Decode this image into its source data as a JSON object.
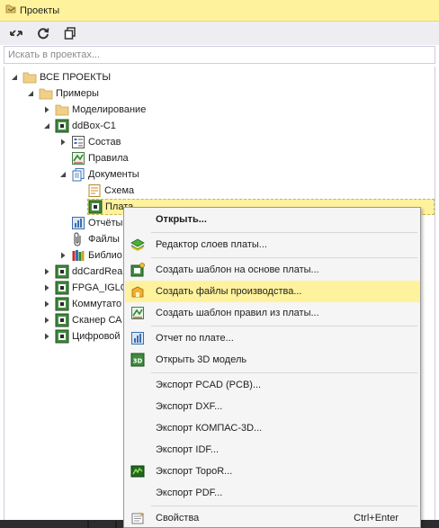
{
  "window": {
    "title": "Проекты"
  },
  "toolbar": {
    "buttons": [
      "sync-icon",
      "refresh-icon",
      "copy-icon"
    ]
  },
  "search": {
    "placeholder": "Искать в проектах..."
  },
  "tree": {
    "root": "ВСЕ ПРОЕКТЫ",
    "examples": "Примеры",
    "modeling": "Моделирование",
    "ddbox": "ddBox-C1",
    "sostav": "Состав",
    "pravila": "Правила",
    "documents": "Документы",
    "schema": "Схема",
    "plata": "Плата",
    "reports": "Отчёты",
    "files": "Файлы",
    "libraries": "Библио",
    "ddcard": "ddCardRea",
    "fpga": "FPGA_IGLO",
    "kommutator": "Коммутато",
    "scanner": "Сканер СА",
    "digital": "Цифровой"
  },
  "context_menu": {
    "open": "Открыть...",
    "layer_editor": "Редактор слоев платы...",
    "create_template": "Создать шаблон на основе платы...",
    "create_production": "Создать файлы производства...",
    "create_rules_template": "Создать шаблон правил из платы...",
    "board_report": "Отчет по плате...",
    "open_3d": "Открыть 3D модель",
    "export_pcad": "Экспорт PCAD (PCB)...",
    "export_dxf": "Экспорт DXF...",
    "export_kompas": "Экспорт КОМПАС-3D...",
    "export_idf": "Экспорт IDF...",
    "export_topor": "Экспорт TopoR...",
    "export_pdf": "Экспорт PDF...",
    "properties": "Свойства",
    "properties_shortcut": "Ctrl+Enter"
  },
  "colors": {
    "highlight": "#fff29d",
    "menu_bg": "#f5f5f5",
    "title_bg": "#fff29d"
  }
}
